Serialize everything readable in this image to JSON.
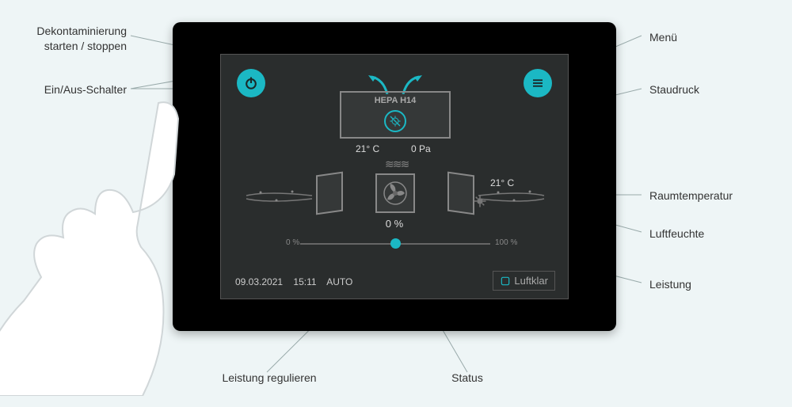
{
  "callouts": {
    "decontam": "Dekontaminierung\nstarten / stoppen",
    "power_switch": "Ein/Aus-Schalter",
    "menu": "Menü",
    "staudruck": "Staudruck",
    "raumtemp": "Raumtemperatur",
    "luftfeuchte": "Luftfeuchte",
    "leistung": "Leistung",
    "status": "Status",
    "leistung_reg": "Leistung regulieren"
  },
  "screen": {
    "hepa_label": "HEPA H14",
    "exhaust_temp": "21° C",
    "staudruck_value": "0 Pa",
    "room_temp": "21° C",
    "power_percent": "0 %",
    "slider_min": "0 %",
    "slider_max": "100 %",
    "date": "09.03.2021",
    "time": "15:11",
    "mode": "AUTO",
    "brand": "Luftklar"
  },
  "colors": {
    "accent": "#1bb8c4",
    "bg": "#eef5f6"
  }
}
